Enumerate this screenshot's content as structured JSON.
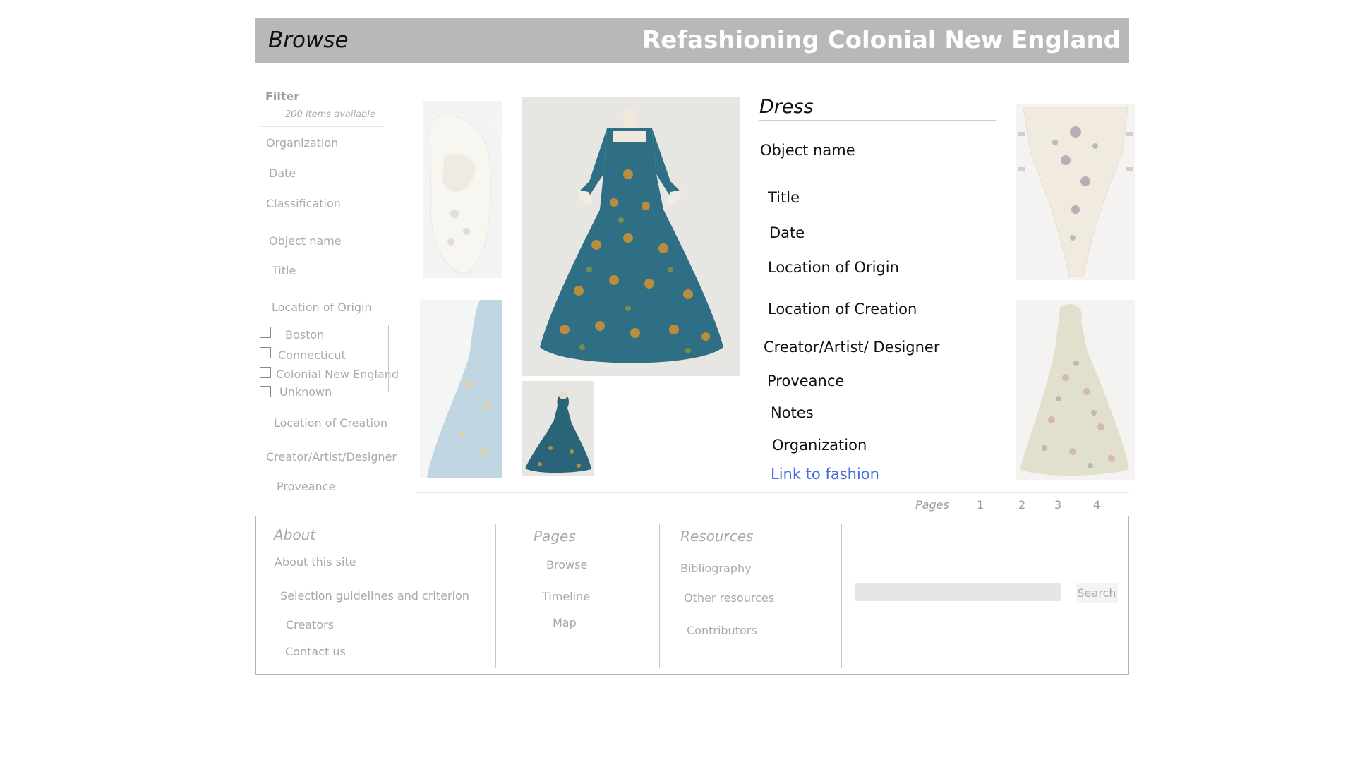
{
  "header": {
    "browse_label": "Browse",
    "site_title": "Refashioning Colonial New England"
  },
  "filter": {
    "title": "Filter",
    "count": "200 items available",
    "facets": [
      "Organization",
      "Date",
      "Classification",
      "Object name",
      "Title",
      "Location of Origin"
    ],
    "origin_options": [
      "Boston",
      "Connecticut",
      "Colonial New England",
      "Unknown"
    ],
    "facets_after": [
      "Location of Creation",
      "Creator/Artist/Designer",
      "Proveance"
    ]
  },
  "detail": {
    "title": "Dress",
    "fields": [
      "Object name",
      "Title",
      "Date",
      "Location of Origin",
      "Location of Creation",
      "Creator/Artist/ Designer",
      "Proveance",
      "Notes",
      "Organization"
    ],
    "link": "Link to fashion"
  },
  "thumbnails": [
    "shoes-thumb",
    "light-blue-gown-thumb",
    "stomacher-thumb",
    "floral-gown-thumb"
  ],
  "pagination": {
    "label": "Pages",
    "pages": [
      "1",
      "2",
      "3",
      "4"
    ]
  },
  "footer": {
    "about": {
      "heading": "About",
      "links": [
        "About this site",
        "Selection guidelines and criterion",
        "Creators",
        "Contact us"
      ]
    },
    "pages": {
      "heading": "Pages",
      "links": [
        "Browse",
        "Timeline",
        "Map"
      ]
    },
    "resources": {
      "heading": "Resources",
      "links": [
        "Bibliography",
        "Other resources",
        "Contributors"
      ]
    },
    "search": {
      "placeholder": "",
      "button": "Search"
    }
  },
  "colors": {
    "header_bg": "#bab8b7",
    "link": "#4a6fdc",
    "dress_teal": "#2f6f86"
  }
}
